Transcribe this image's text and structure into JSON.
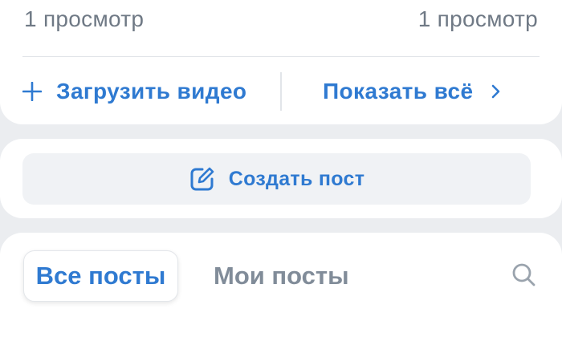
{
  "video_section": {
    "views_left": "1 просмотр",
    "views_right": "1 просмотр",
    "upload_label": "Загрузить видео",
    "show_all_label": "Показать всё"
  },
  "create_post": {
    "label": "Создать пост"
  },
  "posts_tabs": {
    "all_posts": "Все посты",
    "my_posts": "Мои посты"
  },
  "colors": {
    "accent": "#2f7ad1",
    "muted_text": "#6f7985",
    "inactive_tab": "#818c99",
    "background": "#ebedf0",
    "card": "#ffffff"
  },
  "icons": [
    "plus-icon",
    "chevron-right-icon",
    "edit-icon",
    "search-icon"
  ]
}
